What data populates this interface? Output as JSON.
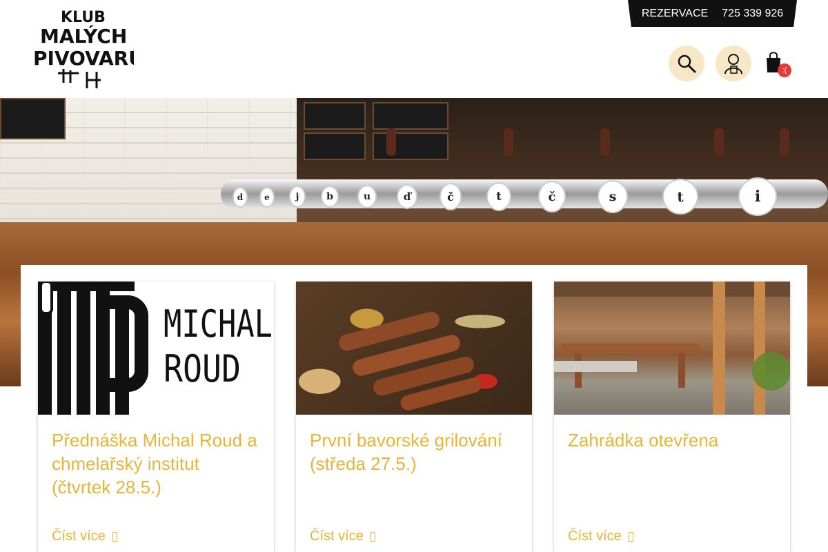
{
  "header": {
    "logo_alt": "KLUB MALÝCH PIVOVARŮ",
    "logo_lines": [
      "KLUB",
      "MALÝCH",
      "PIVOVARŮ"
    ],
    "reservation_label": "REZERVACE",
    "phone": "725 339 926",
    "cart_count": ":("
  },
  "hero": {
    "tap_letters": [
      "d",
      "e",
      "j",
      "b",
      "u",
      "ď",
      "č",
      "t",
      "č",
      "s",
      "t",
      "i"
    ]
  },
  "cards": [
    {
      "title": "Přednáška Michal Roud a chmelařský institut (čtvrtek 28.5.)",
      "more": "Číst více",
      "image_text": [
        "MICHAL",
        "ROUD"
      ]
    },
    {
      "title": "První bavorské grilování (středa 27.5.)",
      "more": "Číst více"
    },
    {
      "title": "Zahrádka otevřena",
      "more": "Číst více"
    }
  ],
  "colors": {
    "accent": "#e7b437",
    "icon_bg": "#f6e8c6",
    "badge": "#e53935"
  }
}
